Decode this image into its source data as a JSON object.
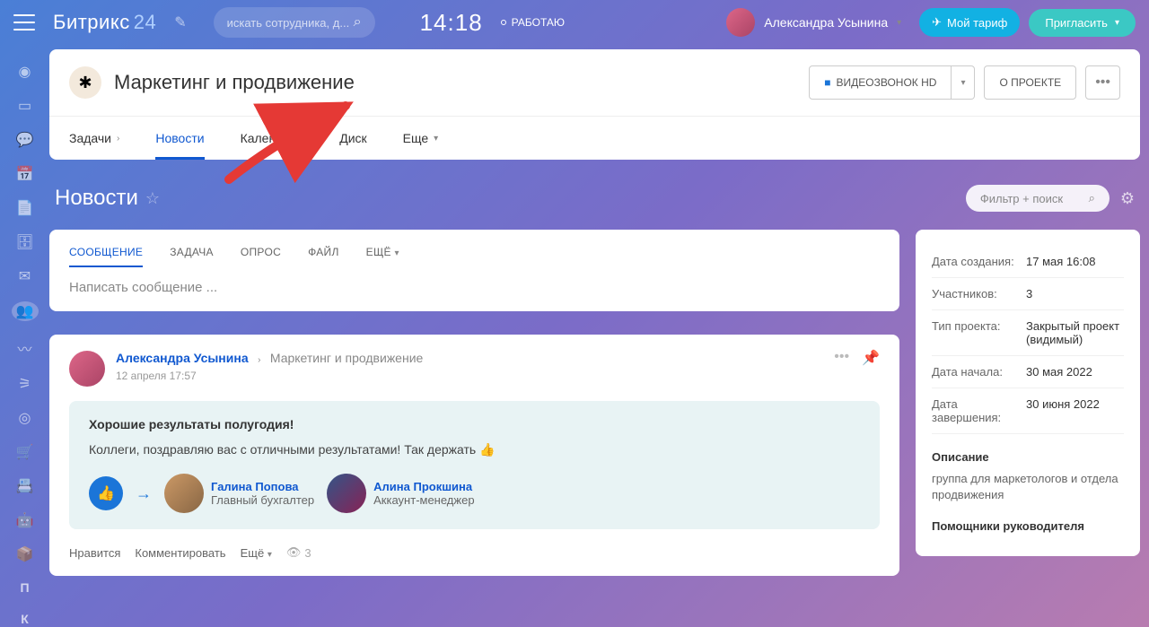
{
  "header": {
    "logo_main": "Битрикс",
    "logo_num": "24",
    "search_placeholder": "искать сотрудника, д...",
    "clock": "14:18",
    "status": "РАБОТАЮ",
    "user_name": "Александра Усынина",
    "tariff_label": "Мой тариф",
    "invite_label": "Пригласить"
  },
  "project": {
    "title": "Маркетинг и продвижение",
    "video_label": "ВИДЕОЗВОНОК HD",
    "about_label": "О ПРОЕКТЕ"
  },
  "tabs": {
    "items": [
      "Задачи",
      "Новости",
      "Календарь",
      "Диск",
      "Еще"
    ],
    "active_index": 1
  },
  "page": {
    "title": "Новости",
    "filter_placeholder": "Фильтр + поиск"
  },
  "compose": {
    "tabs": [
      "СООБЩЕНИЕ",
      "ЗАДАЧА",
      "ОПРОС",
      "ФАЙЛ",
      "ЕЩЁ"
    ],
    "placeholder": "Написать сообщение ..."
  },
  "post": {
    "author": "Александра Усынина",
    "group": "Маркетинг и продвижение",
    "time": "12 апреля 17:57",
    "title": "Хорошие результаты полугодия!",
    "text": "Коллеги, поздравляю вас с отличными результатами! Так держать",
    "people": [
      {
        "name": "Галина Попова",
        "role": "Главный бухгалтер"
      },
      {
        "name": "Алина Прокшина",
        "role": "Аккаунт-менеджер"
      }
    ],
    "footer": {
      "like": "Нравится",
      "comment": "Комментировать",
      "more": "Ещё",
      "views": "3"
    }
  },
  "info": {
    "rows": [
      {
        "label": "Дата создания:",
        "value": "17 мая 16:08"
      },
      {
        "label": "Участников:",
        "value": "3"
      },
      {
        "label": "Тип проекта:",
        "value": "Закрытый проект (видимый)"
      },
      {
        "label": "Дата начала:",
        "value": "30 мая 2022"
      },
      {
        "label": "Дата завершения:",
        "value": "30 июня 2022"
      }
    ],
    "desc_heading": "Описание",
    "desc_text": "группа для маркетологов и отдела продвижения",
    "assist_heading": "Помощники руководителя"
  }
}
